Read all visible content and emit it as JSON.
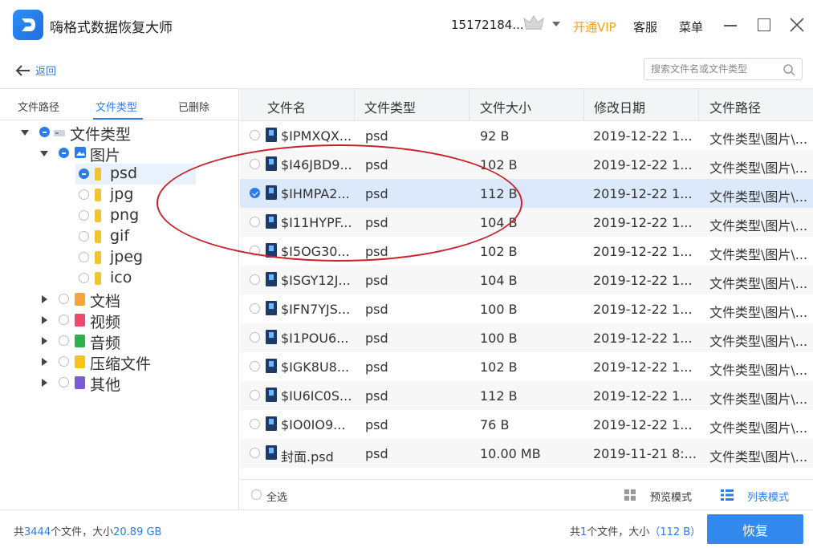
{
  "title_bar": {
    "app_title": "嗨格式数据恢复大师",
    "account": "15172184...",
    "vip": "开通VIP",
    "service": "客服",
    "menu": "菜单",
    "accent_color": "#2b7de9",
    "vip_color": "#f0a417"
  },
  "nav": {
    "back_label": "返回",
    "search_placeholder": "搜索文件名或文件类型"
  },
  "left_tabs": [
    {
      "label": "文件路径",
      "active": false
    },
    {
      "label": "文件类型",
      "active": true
    },
    {
      "label": "已删除",
      "active": false
    }
  ],
  "tree": {
    "root": "文件类型",
    "images": "图片",
    "image_types": [
      "psd",
      "jpg",
      "png",
      "gif",
      "jpeg",
      "ico"
    ],
    "others": [
      "文档",
      "视频",
      "音频",
      "压缩文件",
      "其他"
    ]
  },
  "table": {
    "columns": [
      "文件名",
      "文件类型",
      "文件大小",
      "修改日期",
      "文件路径"
    ],
    "rows": [
      {
        "name": "$IPMXQX...",
        "type": "psd",
        "size": "92 B",
        "date": "2019-12-22 1...",
        "path": "文件类型\\图片\\...",
        "checked": false
      },
      {
        "name": "$I46JBD9...",
        "type": "psd",
        "size": "102 B",
        "date": "2019-12-22 1...",
        "path": "文件类型\\图片\\...",
        "checked": false
      },
      {
        "name": "$IHMPA2...",
        "type": "psd",
        "size": "112 B",
        "date": "2019-12-22 1...",
        "path": "文件类型\\图片\\...",
        "checked": true
      },
      {
        "name": "$I11HYPF...",
        "type": "psd",
        "size": "104 B",
        "date": "2019-12-22 1...",
        "path": "文件类型\\图片\\...",
        "checked": false
      },
      {
        "name": "$I5OG30...",
        "type": "psd",
        "size": "102 B",
        "date": "2019-12-22 1...",
        "path": "文件类型\\图片\\...",
        "checked": false
      },
      {
        "name": "$ISGY12J...",
        "type": "psd",
        "size": "104 B",
        "date": "2019-12-22 1...",
        "path": "文件类型\\图片\\...",
        "checked": false
      },
      {
        "name": "$IFN7YJS...",
        "type": "psd",
        "size": "100 B",
        "date": "2019-12-22 1...",
        "path": "文件类型\\图片\\...",
        "checked": false
      },
      {
        "name": "$I1POU6...",
        "type": "psd",
        "size": "100 B",
        "date": "2019-12-22 1...",
        "path": "文件类型\\图片\\...",
        "checked": false
      },
      {
        "name": "$IGK8U8...",
        "type": "psd",
        "size": "102 B",
        "date": "2019-12-22 1...",
        "path": "文件类型\\图片\\...",
        "checked": false
      },
      {
        "name": "$IU6IC0S...",
        "type": "psd",
        "size": "112 B",
        "date": "2019-12-22 1...",
        "path": "文件类型\\图片\\...",
        "checked": false
      },
      {
        "name": "$IO0IO9...",
        "type": "psd",
        "size": "76 B",
        "date": "2019-12-22 1...",
        "path": "文件类型\\图片\\...",
        "checked": false
      },
      {
        "name": "封面.psd",
        "type": "psd",
        "size": "10.00 MB",
        "date": "2019-11-21 8:...",
        "path": "文件类型\\图片\\...",
        "checked": false
      }
    ]
  },
  "bottom_bar": {
    "select_all": "全选",
    "preview_mode": "预览模式",
    "list_mode": "列表模式"
  },
  "status": {
    "total_prefix": "共",
    "total_count": "3444",
    "total_mid": "个文件，大小",
    "total_size": "20.89 GB",
    "sel_prefix": "共",
    "sel_count": "1",
    "sel_mid": "个文件，大小",
    "sel_size": "（112 B）",
    "recover_label": "恢复"
  }
}
